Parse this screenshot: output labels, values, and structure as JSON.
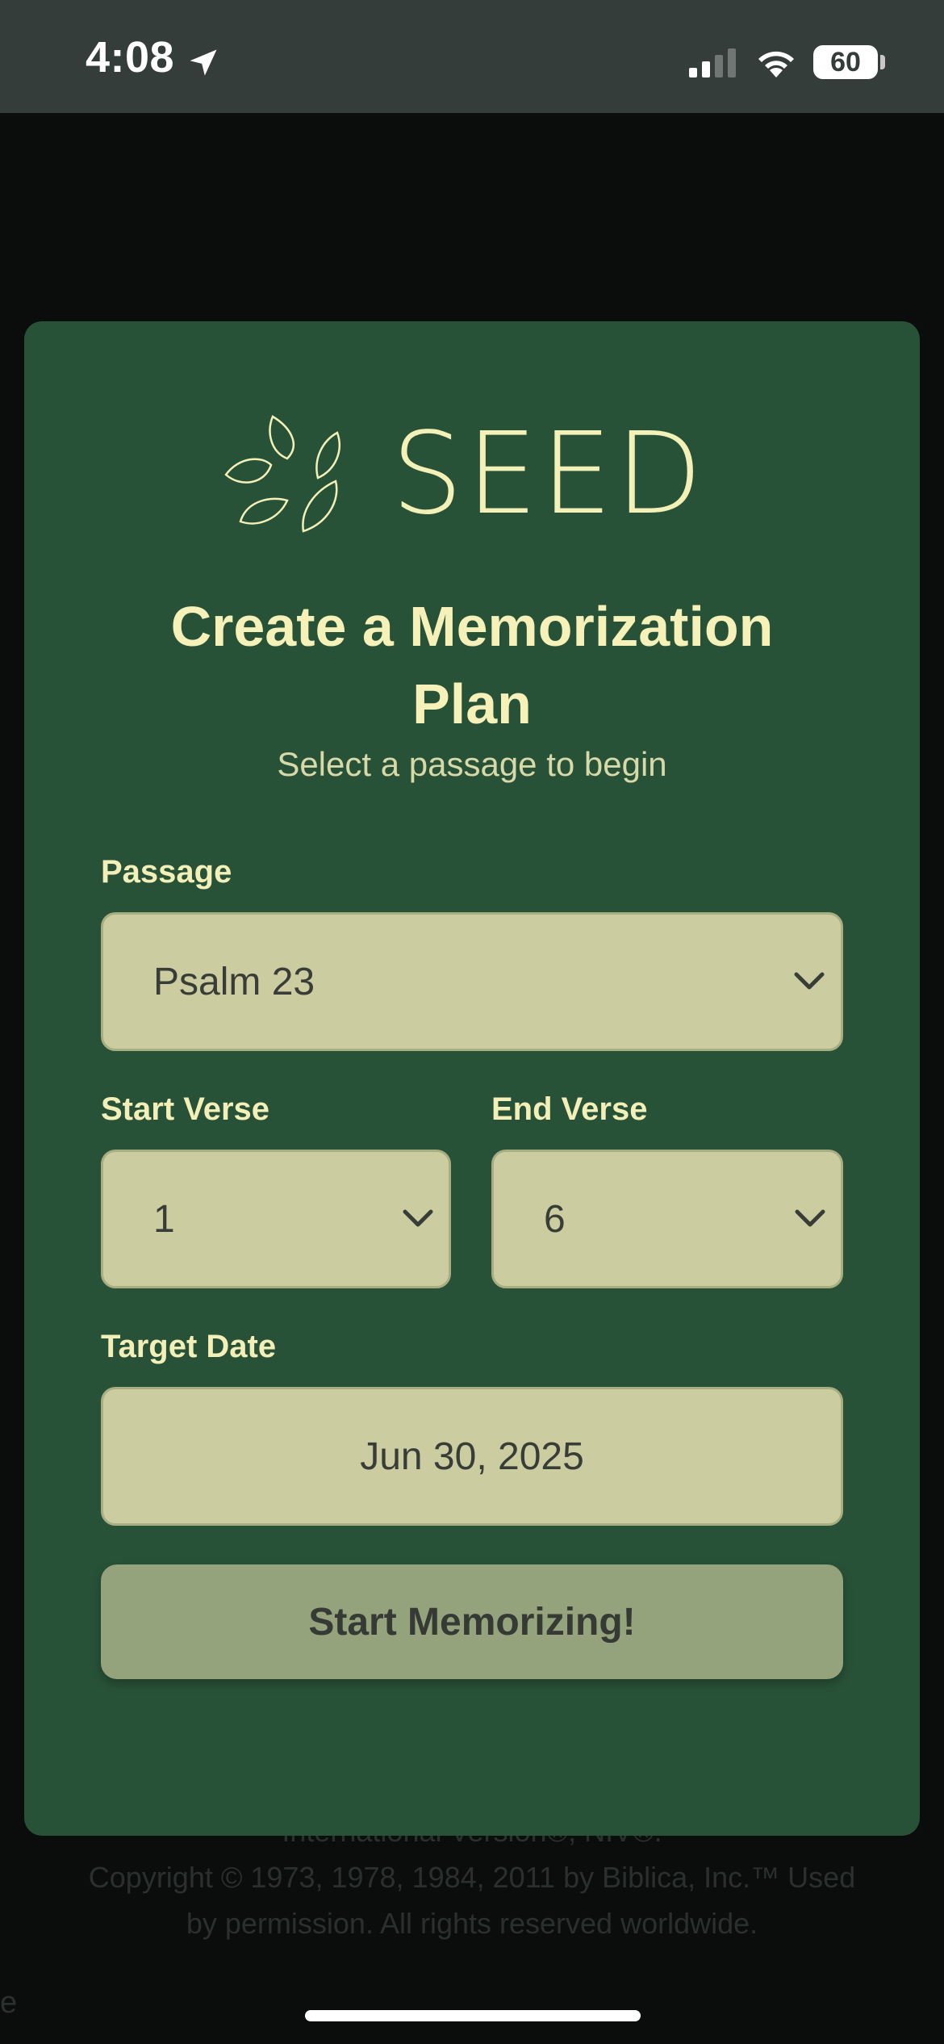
{
  "status_bar": {
    "time": "4:08",
    "battery": "60"
  },
  "background_footer": {
    "line1": "International Version®, NIV®.",
    "line2": "Copyright © 1973, 1978, 1984, 2011 by Biblica, Inc.™ Used",
    "line3": "by permission. All rights reserved worldwide.",
    "edge_text": "e"
  },
  "card": {
    "brand": "SEED",
    "title_line1": "Create a Memorization",
    "title_line2": "Plan",
    "subtitle": "Select a passage to begin",
    "passage": {
      "label": "Passage",
      "value": "Psalm 23"
    },
    "start_verse": {
      "label": "Start Verse",
      "value": "1"
    },
    "end_verse": {
      "label": "End Verse",
      "value": "6"
    },
    "target_date": {
      "label": "Target Date",
      "value": "Jun 30, 2025"
    },
    "start_button": "Start Memorizing!"
  },
  "colors": {
    "card_bg": "#285237",
    "accent_text": "#f5f1b9",
    "field_bg": "#cbcda0",
    "button_bg": "#94a37c"
  },
  "icons": [
    "location-arrow-icon",
    "cellular-signal-icon",
    "wifi-icon",
    "battery-icon",
    "seed-leaves-logo-icon",
    "chevron-down-icon"
  ]
}
